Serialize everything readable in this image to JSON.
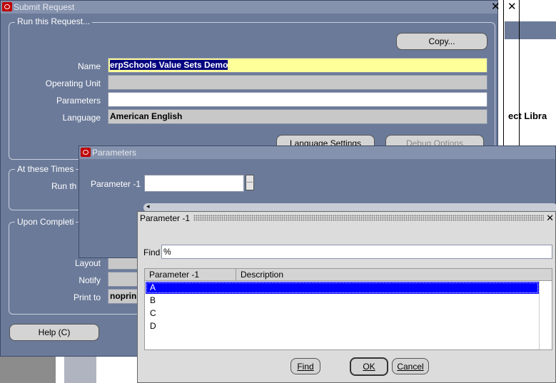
{
  "background": {
    "partial_text": "ect Libra"
  },
  "submit_request": {
    "title": "Submit Request",
    "run_group_title": "Run this Request...",
    "copy_button": "Copy...",
    "name_label": "Name",
    "name_value": "erpSchools Value Sets Demo",
    "operating_unit_label": "Operating Unit",
    "operating_unit_value": "",
    "parameters_label": "Parameters",
    "parameters_value": "",
    "language_label": "Language",
    "language_value": "American English",
    "language_settings_button": "Language Settings",
    "debug_options_button": "Debug Options",
    "at_these_times_title": "At these Times",
    "run_label_partial": "Run th",
    "upon_completion_title": "Upon Completi",
    "layout_label": "Layout",
    "notify_label": "Notify",
    "print_to_label": "Print to",
    "print_to_value": "noprin",
    "help_button": "Help (C)"
  },
  "parameters_window": {
    "title": "Parameters",
    "param_label": "Parameter -1",
    "param_value": "",
    "lov_button": "..."
  },
  "lov_dialog": {
    "title": "Parameter -1",
    "find_label": "Find",
    "find_value": "%",
    "columns": [
      "Parameter -1",
      "Description"
    ],
    "rows": [
      "A",
      "B",
      "C",
      "D"
    ],
    "selected_row": "A",
    "find_button": "Find",
    "ok_button": "OK",
    "cancel_button": "Cancel"
  }
}
